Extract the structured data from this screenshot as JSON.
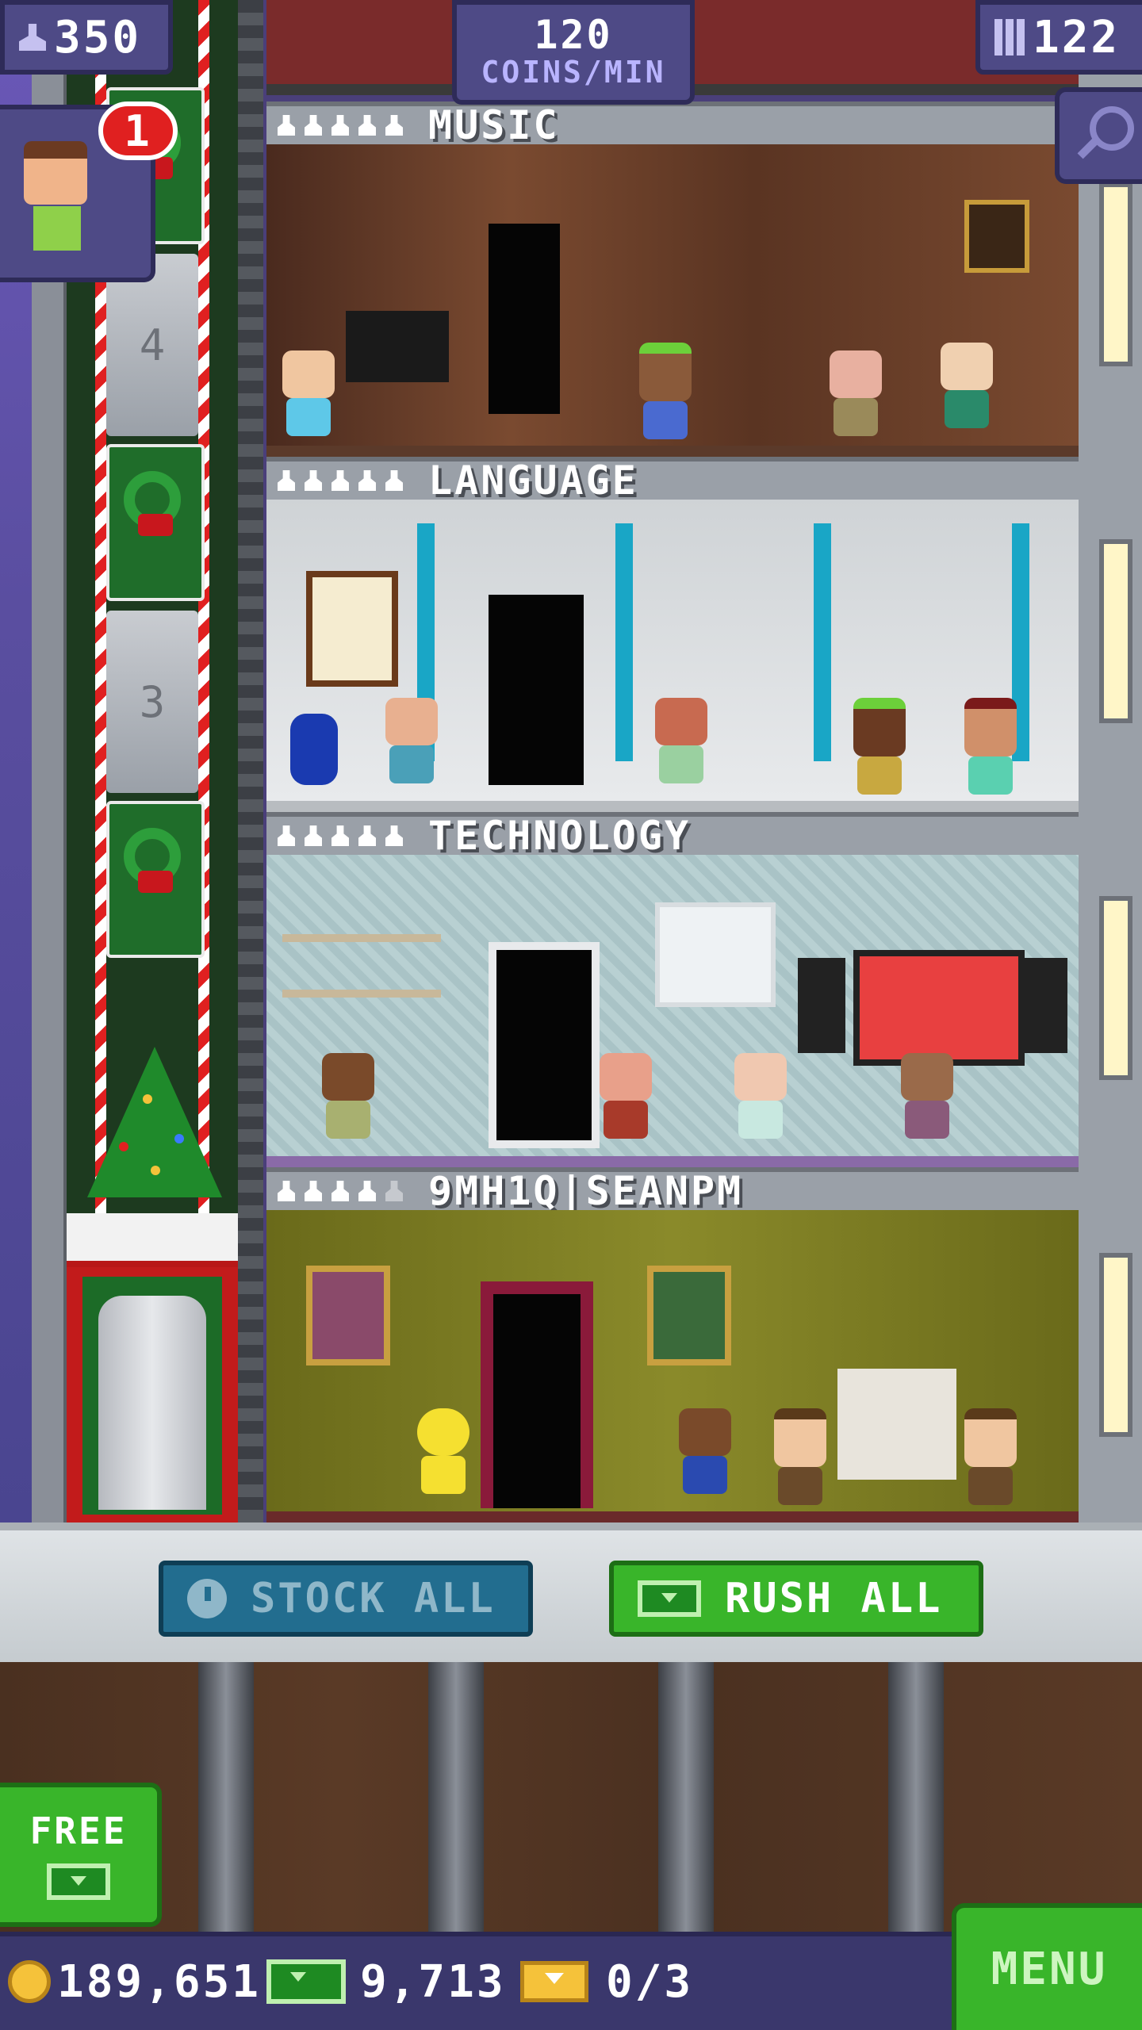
{
  "hud": {
    "population": "350",
    "coins_per_min_value": "120",
    "coins_per_min_label": "COINS/MIN",
    "floor_count": "122"
  },
  "notification": {
    "badge_count": "1"
  },
  "elevator": {
    "floor_numbers": [
      "4",
      "3"
    ]
  },
  "floors": [
    {
      "name": "MUSIC",
      "stars": 5,
      "wall": "#6b3a2a"
    },
    {
      "name": "LANGUAGE",
      "stars": 5,
      "wall": "#d9dcdf"
    },
    {
      "name": "TECHNOLOGY",
      "stars": 5,
      "wall": "#a9c3c6"
    },
    {
      "name": "9MH1Q|SEANPM",
      "stars": 4,
      "wall": "#7a7a20"
    }
  ],
  "actions": {
    "stock_all_label": "STOCK ALL",
    "rush_all_label": "RUSH ALL"
  },
  "free_button": {
    "label": "FREE"
  },
  "resources": {
    "coins": "189,651",
    "bux": "9,713",
    "tickets": "0/3"
  },
  "menu_label": "MENU",
  "colors": {
    "hud_bg": "#4e4a86",
    "green_button": "#39b52a",
    "blue_button": "#226d8f",
    "badge_red": "#e02020",
    "coin_gold": "#f5c23a"
  }
}
